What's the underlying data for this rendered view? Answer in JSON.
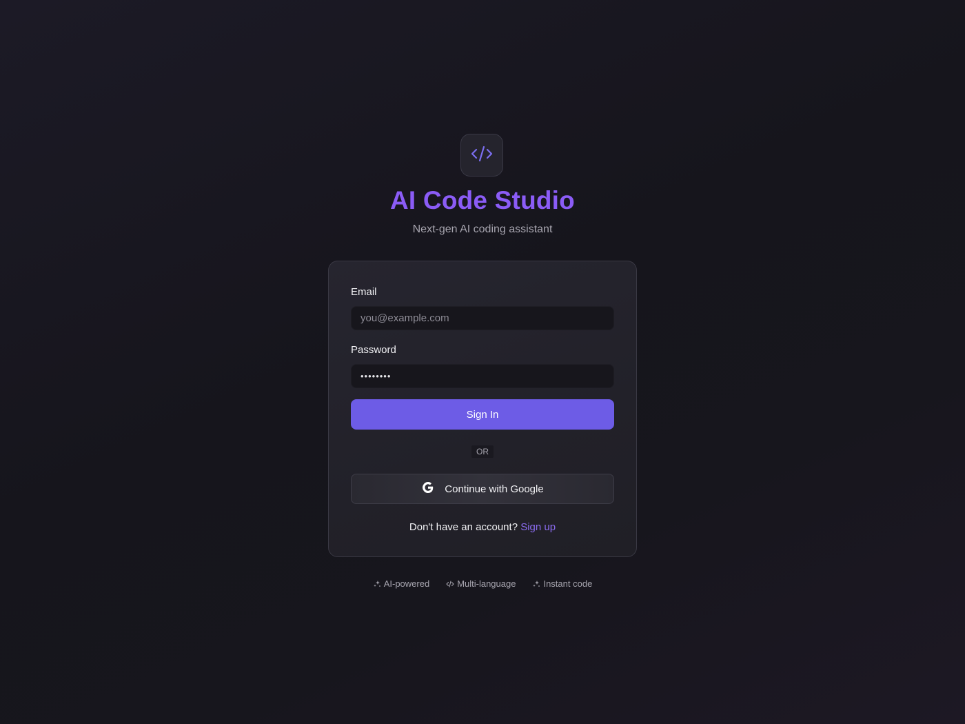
{
  "brand": {
    "logo_icon": "code-icon",
    "title": "AI Code Studio",
    "subtitle": "Next-gen AI coding assistant",
    "accent_color": "#8b5cf6"
  },
  "form": {
    "email_label": "Email",
    "email_placeholder": "you@example.com",
    "email_value": "",
    "password_label": "Password",
    "password_value": "••••••••",
    "sign_in_label": "Sign In",
    "divider_label": "OR",
    "google_label": "Continue with Google",
    "google_icon": "google-icon",
    "signup_prompt": "Don't have an account?",
    "signup_link": "Sign up",
    "primary_color": "#6d5ce6"
  },
  "features": [
    {
      "icon": "sparkles-icon",
      "label": "AI-powered"
    },
    {
      "icon": "code-icon",
      "label": "Multi-language"
    },
    {
      "icon": "sparkles-icon",
      "label": "Instant code"
    }
  ]
}
